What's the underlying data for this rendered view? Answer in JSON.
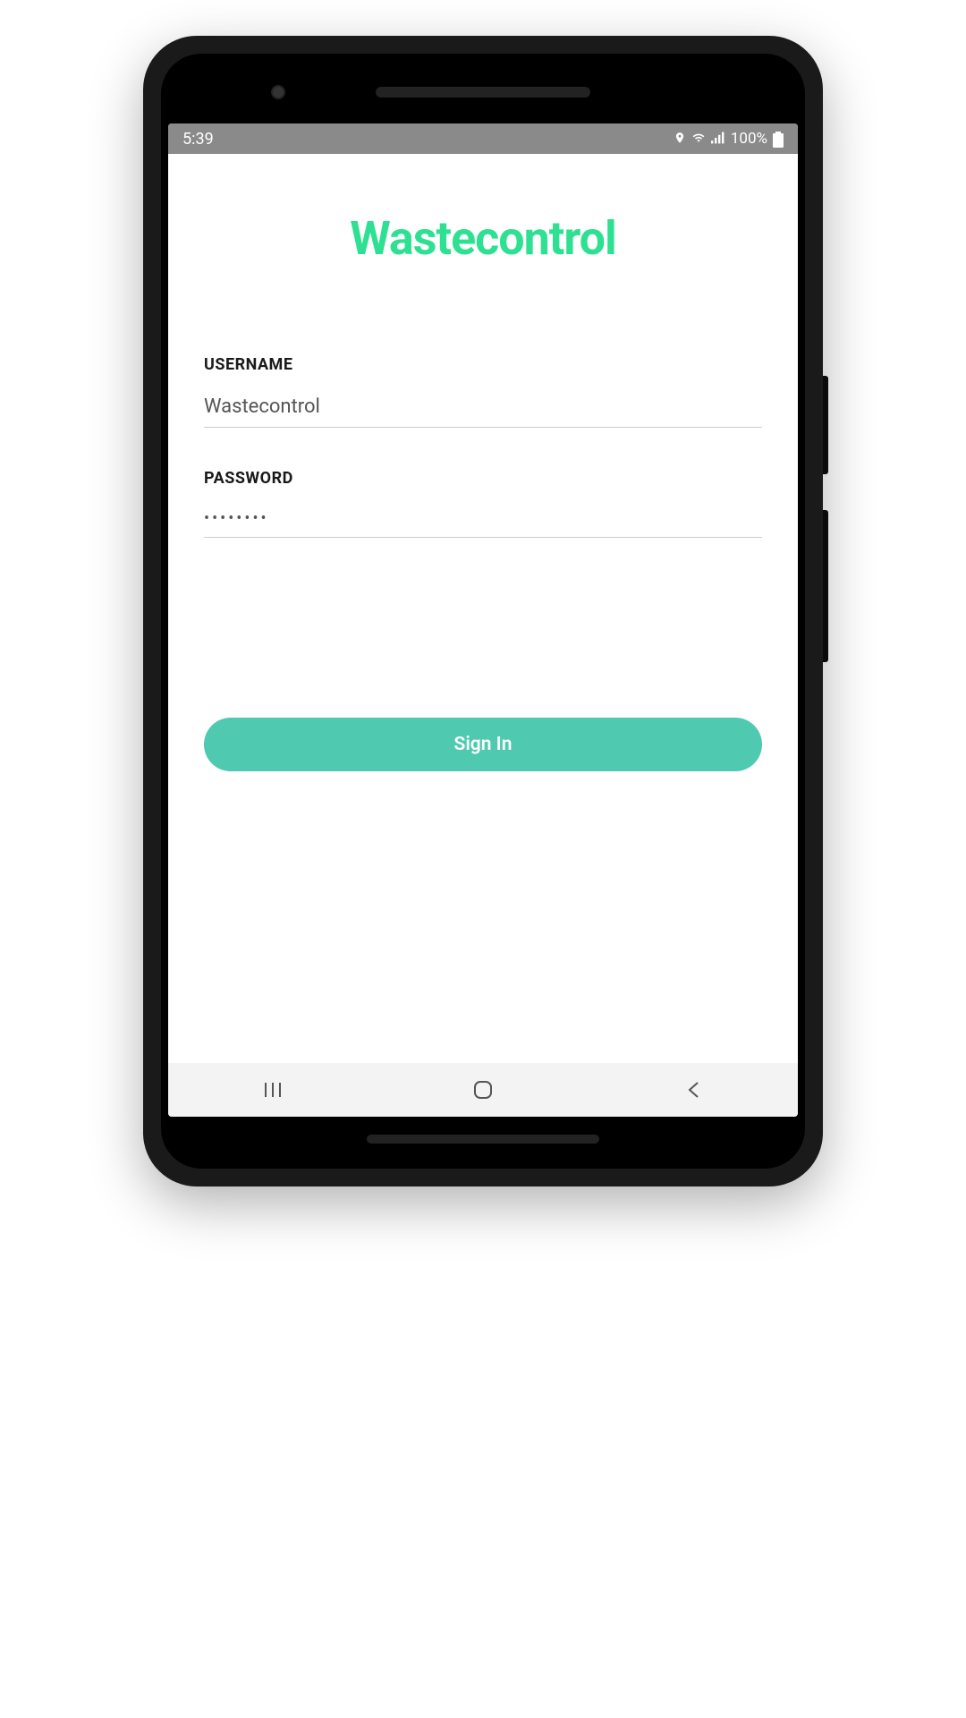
{
  "status_bar": {
    "time": "5:39",
    "battery_percent": "100%"
  },
  "app": {
    "title": "Wastecontrol"
  },
  "form": {
    "username_label": "USERNAME",
    "username_value": "Wastecontrol",
    "password_label": "PASSWORD",
    "password_value": "••••••••"
  },
  "actions": {
    "sign_in_label": "Sign In"
  },
  "colors": {
    "brand_green": "#2ee091",
    "button_teal": "#4fc9b0"
  }
}
